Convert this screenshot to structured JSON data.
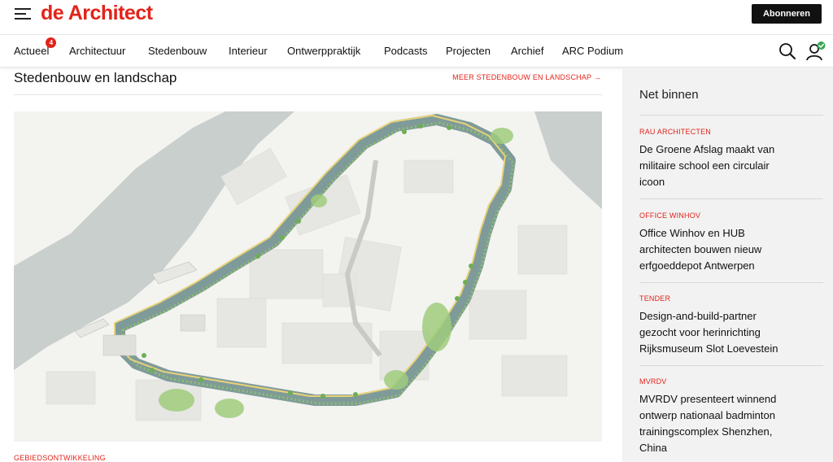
{
  "header": {
    "logo": "de Architect",
    "subscribe_label": "Abonneren"
  },
  "nav": {
    "items": [
      {
        "label": "Actueel",
        "badge": "4"
      },
      {
        "label": "Architectuur"
      },
      {
        "label": "Stedenbouw"
      },
      {
        "label": "Interieur"
      },
      {
        "label": "Ontwerppraktijk"
      },
      {
        "label": "Podcasts"
      },
      {
        "label": "Projecten"
      },
      {
        "label": "Archief"
      },
      {
        "label": "ARC Podium"
      }
    ],
    "icons": [
      "search-icon",
      "user-icon",
      "check-icon"
    ]
  },
  "main": {
    "section_title": "Stedenbouw en landschap",
    "more_link": "MEER STEDENBOUW EN LANDSCHAP",
    "category": "GEBIEDSONTWIKKELING"
  },
  "sidebar": {
    "title": "Net binnen",
    "items": [
      {
        "category": "RAU ARCHITECTEN",
        "headline": "De Groene Afslag maakt van militaire school een circulair icoon"
      },
      {
        "category": "OFFICE WINHOV",
        "headline": "Office Winhov en HUB architecten bouwen nieuw erfgoeddepot Antwerpen"
      },
      {
        "category": "TENDER",
        "headline": "Design-and-build-partner gezocht voor herinrichting Rijksmuseum Slot Loevestein"
      },
      {
        "category": "MVRDV",
        "headline": "MVRDV presenteert winnend ontwerp nationaal badminton trainingscomplex Shenzhen, China"
      }
    ]
  },
  "colors": {
    "accent": "#e2231a",
    "water": "#c9cfcd",
    "quay_water": "#7f9b99",
    "green": "#8fbf6a",
    "path": "#e8d27a"
  }
}
